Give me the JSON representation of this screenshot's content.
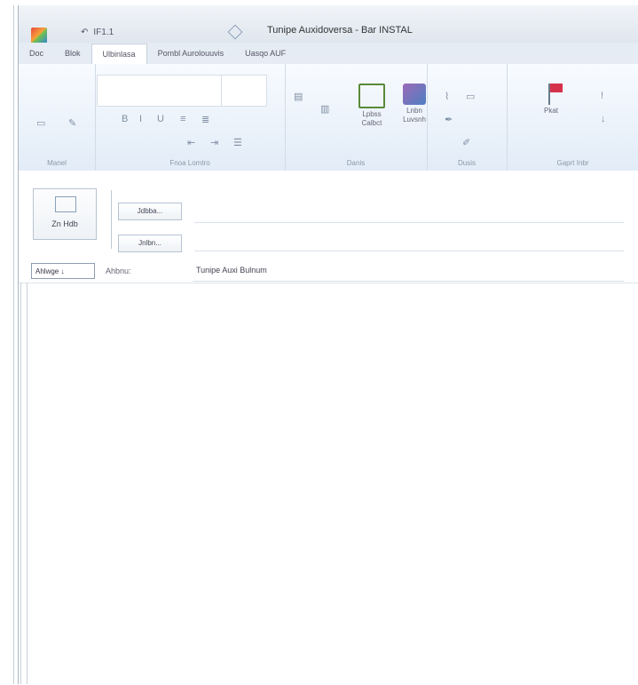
{
  "window": {
    "title": "Tunipe Auxidoversa - Bar INSTAL",
    "qat": [
      "↶",
      "IF1.1"
    ]
  },
  "tabs": [
    "Doc",
    "Blok",
    "Ulbinlasa",
    "Pombl Aurolouuvis",
    "Uasqo AUF"
  ],
  "ribbon": {
    "groups": [
      "Manel",
      "Fnoa Lomtro",
      "Danis",
      "Dusis",
      "Gaprt Inbr"
    ],
    "buttons": [
      {
        "label": "Lpbss\nCalbct",
        "icon": "address-book-icon"
      },
      {
        "label": "Lnbn\nLuvsnh",
        "icon": "check-names-icon"
      },
      {
        "label": "Pkat",
        "icon": "flag-icon"
      }
    ]
  },
  "compose": {
    "send_label": "Zn Hdb",
    "to_label": "Jdbba...",
    "cc_label": "Jnlbn...",
    "account_label": "Ahlwge ↓",
    "subject_label": "Ahbnu:",
    "subject_value": "Tunipe Auxi Bulnum",
    "body": ""
  }
}
